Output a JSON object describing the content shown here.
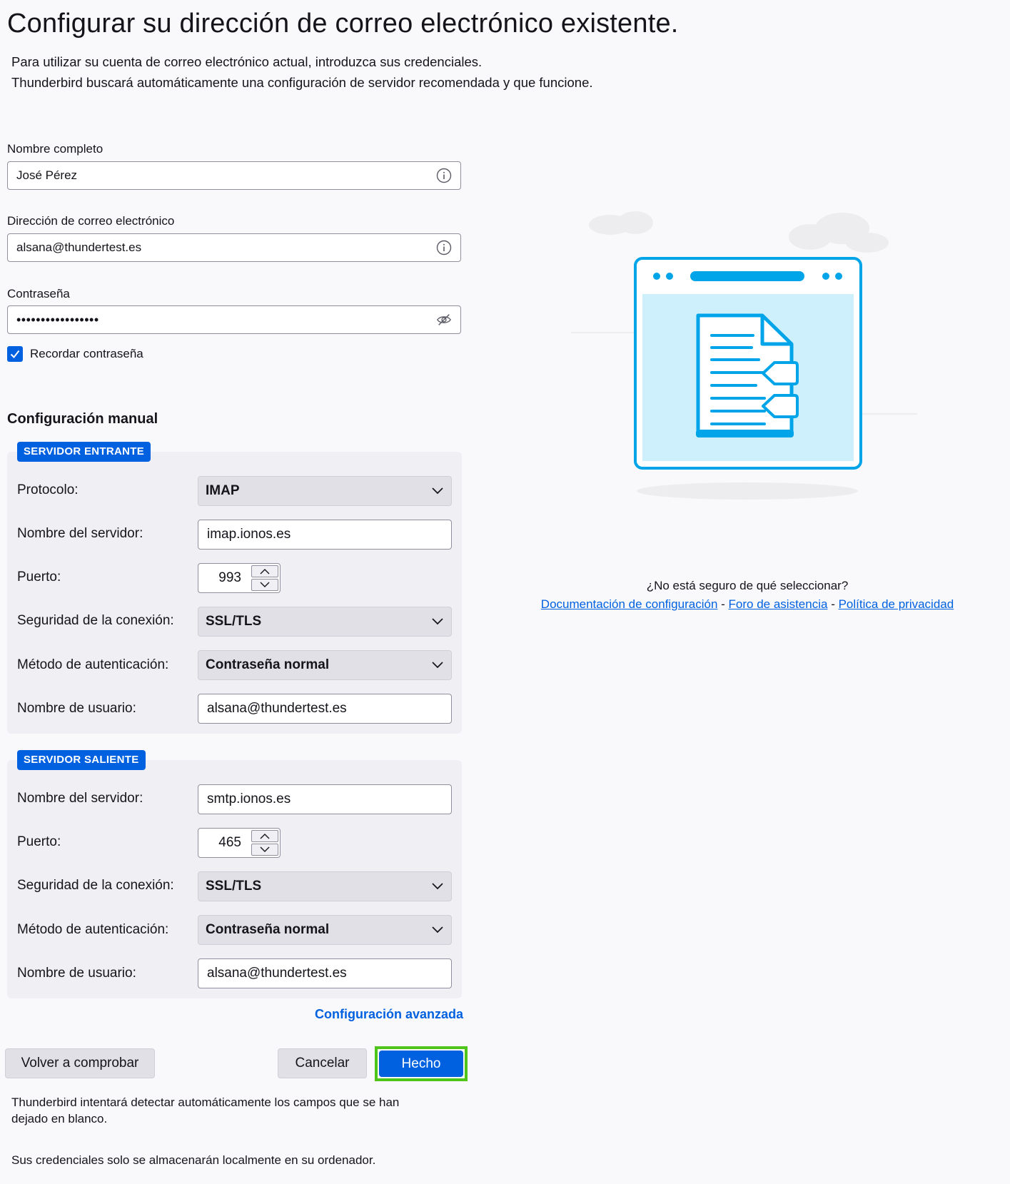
{
  "header": {
    "title": "Configurar su dirección de correo electrónico existente.",
    "intro_line1": "Para utilizar su cuenta de correo electrónico actual, introduzca sus credenciales.",
    "intro_line2": "Thunderbird buscará automáticamente una configuración de servidor recomendada y que funcione."
  },
  "form": {
    "name_label": "Nombre completo",
    "name_value": "José Pérez",
    "email_label": "Dirección de correo electrónico",
    "email_value": "alsana@thundertest.es",
    "password_label": "Contraseña",
    "password_value": "•••••••••••••••••",
    "remember_label": "Recordar contraseña",
    "remember_checked": true
  },
  "manual": {
    "title": "Configuración manual",
    "incoming": {
      "badge": "SERVIDOR ENTRANTE",
      "protocol_label": "Protocolo:",
      "protocol_value": "IMAP",
      "server_label": "Nombre del servidor:",
      "server_value": "imap.ionos.es",
      "port_label": "Puerto:",
      "port_value": "993",
      "security_label": "Seguridad de la conexión:",
      "security_value": "SSL/TLS",
      "auth_label": "Método de autenticación:",
      "auth_value": "Contraseña normal",
      "user_label": "Nombre de usuario:",
      "user_value": "alsana@thundertest.es"
    },
    "outgoing": {
      "badge": "SERVIDOR SALIENTE",
      "server_label": "Nombre del servidor:",
      "server_value": "smtp.ionos.es",
      "port_label": "Puerto:",
      "port_value": "465",
      "security_label": "Seguridad de la conexión:",
      "security_value": "SSL/TLS",
      "auth_label": "Método de autenticación:",
      "auth_value": "Contraseña normal",
      "user_label": "Nombre de usuario:",
      "user_value": "alsana@thundertest.es"
    },
    "advanced_link": "Configuración avanzada"
  },
  "buttons": {
    "retest": "Volver a comprobar",
    "cancel": "Cancelar",
    "done": "Hecho"
  },
  "notes": {
    "autodetect_line1": "Thunderbird intentará detectar automáticamente los campos que se han",
    "autodetect_line2": "dejado en blanco.",
    "local_storage": "Sus credenciales solo se almacenarán localmente en su ordenador."
  },
  "help": {
    "question": "¿No está seguro de qué seleccionar?",
    "link_docs": "Documentación de configuración",
    "link_forum": "Foro de asistencia",
    "link_privacy": "Política de privacidad",
    "separator": "-"
  },
  "colors": {
    "accent": "#0061e0",
    "illustration": "#00a4e8",
    "focus": "#4fc51b"
  }
}
